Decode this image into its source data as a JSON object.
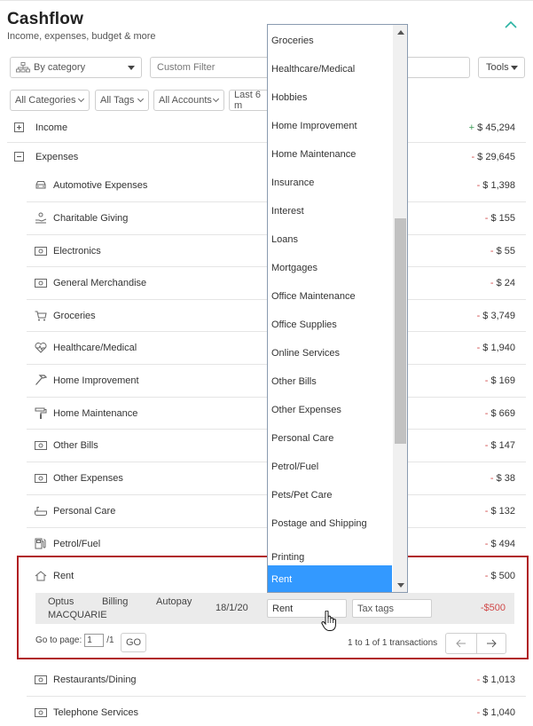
{
  "header": {
    "title": "Cashflow",
    "subtitle": "Income, expenses, budget & more"
  },
  "toolbar": {
    "group_by": "By category",
    "custom_filter_placeholder": "Custom Filter",
    "tools_label": "Tools"
  },
  "filters": {
    "categories": "All Categories",
    "tags": "All Tags",
    "accounts": "All Accounts",
    "range": "Last 6 m"
  },
  "summary": {
    "income": {
      "label": "Income",
      "sign": "+",
      "amount": "$ 45,294"
    },
    "expenses": {
      "label": "Expenses",
      "sign": "-",
      "amount": "$ 29,645"
    }
  },
  "categories": [
    {
      "label": "Automotive Expenses",
      "amount": "$ 1,398",
      "icon": "car-icon"
    },
    {
      "label": "Charitable Giving",
      "amount": "$ 155",
      "icon": "giving-hand-icon"
    },
    {
      "label": "Electronics",
      "amount": "$ 55",
      "icon": "cash-icon"
    },
    {
      "label": "General Merchandise",
      "amount": "$ 24",
      "icon": "cash-icon"
    },
    {
      "label": "Groceries",
      "amount": "$ 3,749",
      "icon": "cart-icon"
    },
    {
      "label": "Healthcare/Medical",
      "amount": "$ 1,940",
      "icon": "heart-pulse-icon"
    },
    {
      "label": "Home Improvement",
      "amount": "$ 169",
      "icon": "hammer-icon"
    },
    {
      "label": "Home Maintenance",
      "amount": "$ 669",
      "icon": "paint-roller-icon"
    },
    {
      "label": "Other Bills",
      "amount": "$ 147",
      "icon": "cash-icon"
    },
    {
      "label": "Other Expenses",
      "amount": "$ 38",
      "icon": "cash-icon"
    },
    {
      "label": "Personal Care",
      "amount": "$ 132",
      "icon": "bathtub-icon"
    },
    {
      "label": "Petrol/Fuel",
      "amount": "$ 494",
      "icon": "fuel-pump-icon"
    },
    {
      "label": "Rent",
      "amount": "$ 500",
      "icon": "house-icon"
    },
    {
      "label": "Restaurants/Dining",
      "amount": "$ 1,013",
      "icon": "cash-icon"
    },
    {
      "label": "Telephone Services",
      "amount": "$ 1,040",
      "icon": "cash-icon"
    }
  ],
  "transaction": {
    "desc_1": "Optus",
    "desc_2": "Billing",
    "desc_3": "Autopay",
    "desc_4": "MACQUARIE",
    "date": "18/1/20",
    "category": "Rent",
    "tags_placeholder": "Tax tags",
    "amount": "-$500"
  },
  "pager": {
    "go_to_label": "Go to page:",
    "page_value": "1",
    "page_total": "/1",
    "go_label": "GO",
    "count_text": "1 to 1 of 1 transactions"
  },
  "dropdown": {
    "options": [
      "Groceries",
      "Healthcare/Medical",
      "Hobbies",
      "Home Improvement",
      "Home Maintenance",
      "Insurance",
      "Interest",
      "Loans",
      "Mortgages",
      "Office Maintenance",
      "Office Supplies",
      "Online Services",
      "Other Bills",
      "Other Expenses",
      "Personal Care",
      "Petrol/Fuel",
      "Pets/Pet Care",
      "Postage and Shipping",
      "Printing",
      "Rent"
    ],
    "selected": "Rent"
  },
  "colors": {
    "accent_teal": "#2bb3a3",
    "negative": "#d04848",
    "positive": "#3a9a55",
    "highlight_border": "#b01e23",
    "dropdown_selected": "#3399ff"
  }
}
